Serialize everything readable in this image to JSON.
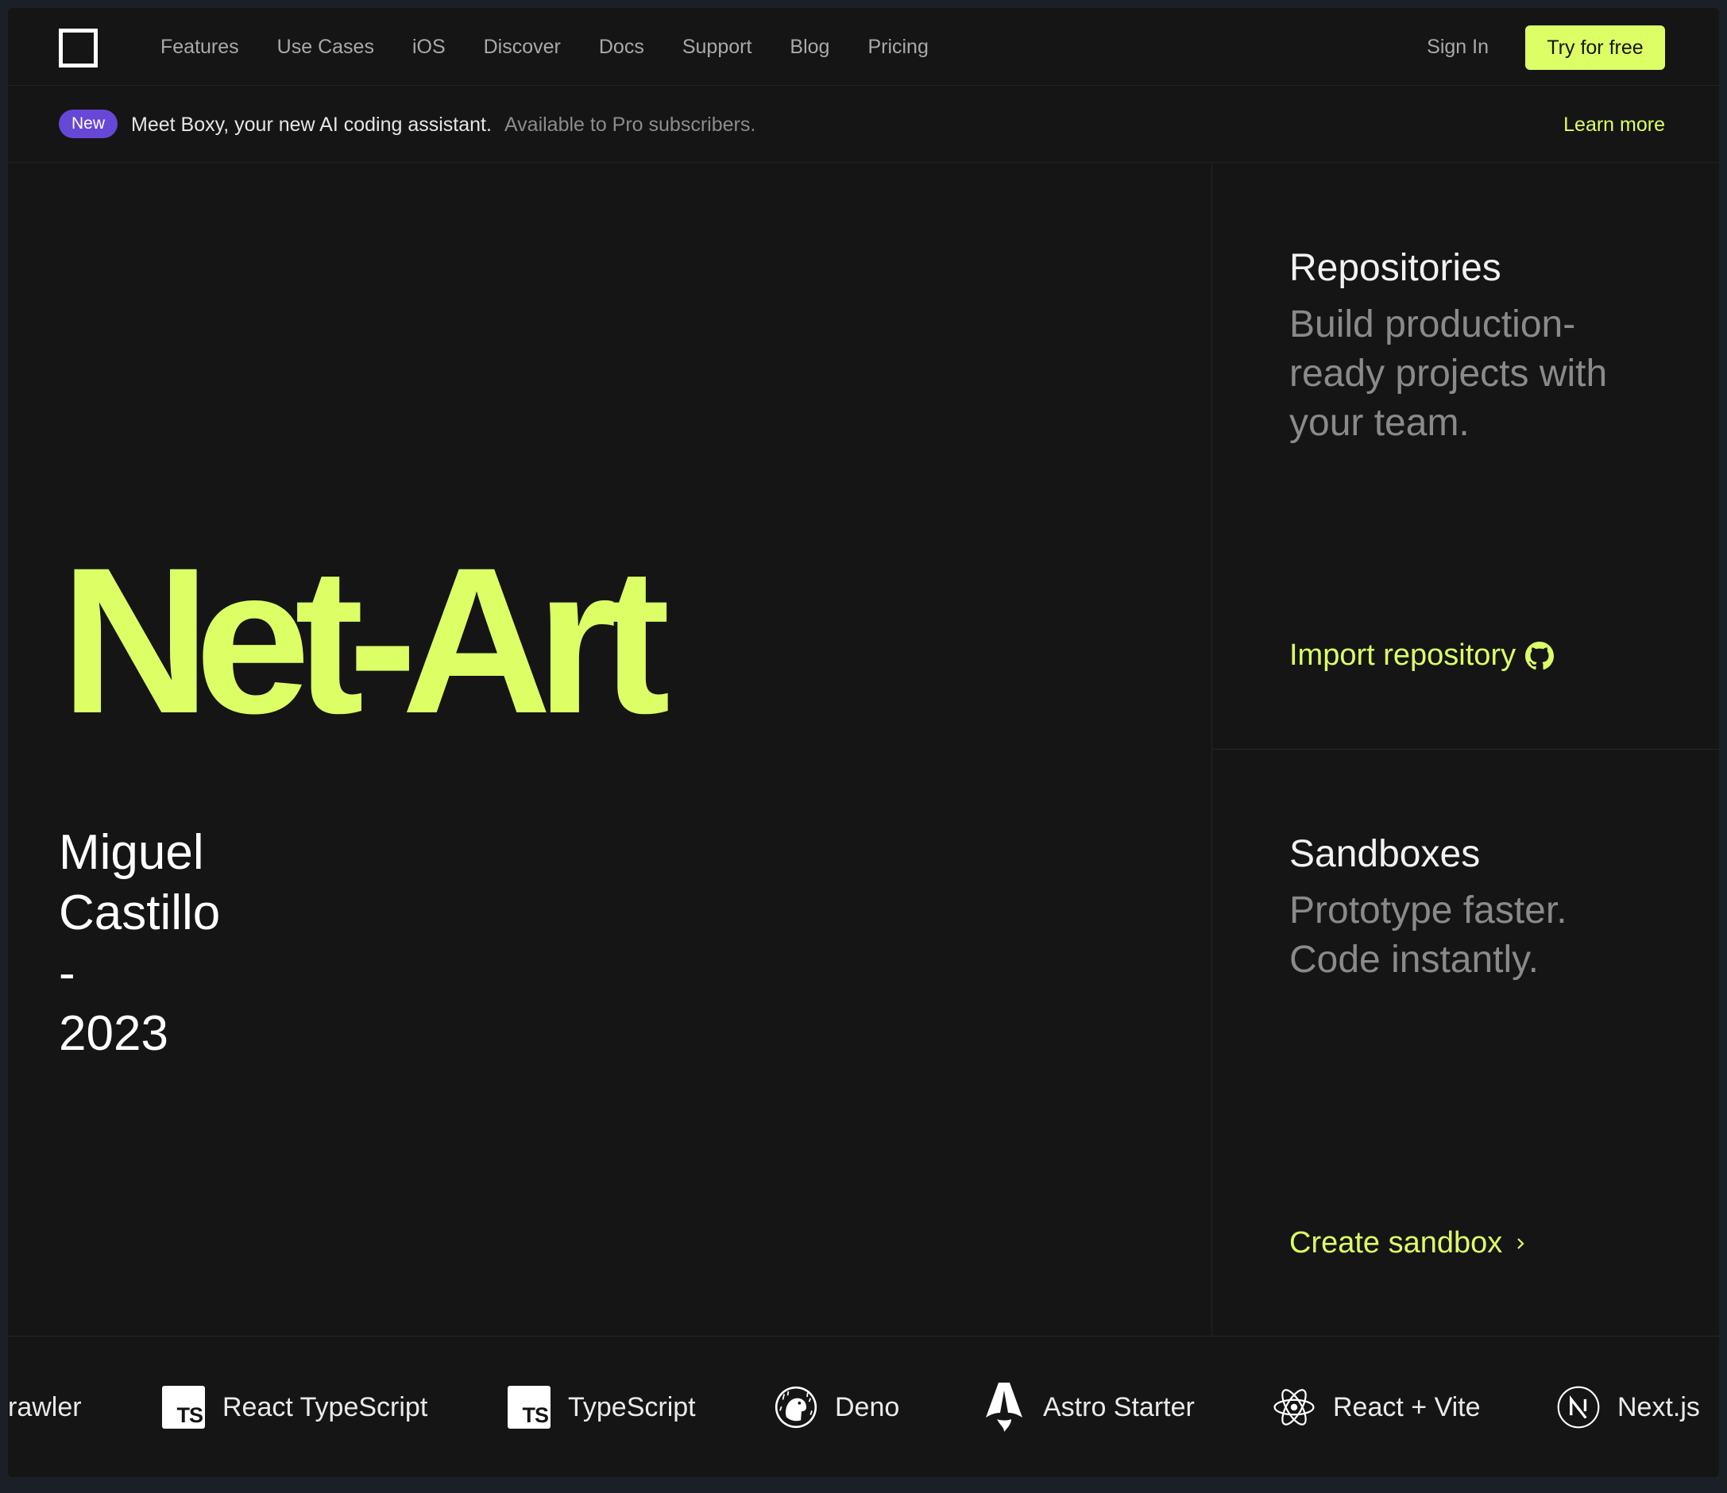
{
  "nav": {
    "links": [
      "Features",
      "Use Cases",
      "iOS",
      "Discover",
      "Docs",
      "Support",
      "Blog",
      "Pricing"
    ],
    "sign_in": "Sign In",
    "cta": "Try for free"
  },
  "announcement": {
    "badge": "New",
    "message": "Meet Boxy, your new AI coding assistant.",
    "sub": "Available to Pro subscribers.",
    "link": "Learn more"
  },
  "hero": {
    "title": "Net-Art",
    "byline": [
      "Miguel",
      "Castillo",
      "-",
      "2023"
    ]
  },
  "panels": {
    "repositories": {
      "title": "Repositories",
      "description": "Build production-ready projects with your team.",
      "link": "Import repository",
      "link_icon": "github-icon"
    },
    "sandboxes": {
      "title": "Sandboxes",
      "description": "Prototype faster. Code instantly.",
      "link": "Create sandbox",
      "link_icon": "chevron-right-icon"
    }
  },
  "templates": [
    {
      "label": "rawler",
      "icon": ""
    },
    {
      "label": "React TypeScript",
      "icon": "typescript-icon"
    },
    {
      "label": "TypeScript",
      "icon": "typescript-icon"
    },
    {
      "label": "Deno",
      "icon": "deno-icon"
    },
    {
      "label": "Astro Starter",
      "icon": "astro-icon"
    },
    {
      "label": "React + Vite",
      "icon": "react-icon"
    },
    {
      "label": "Next.js",
      "icon": "nextjs-icon"
    }
  ],
  "colors": {
    "accent": "#dcff66",
    "background": "#151515",
    "badge": "#6647d6",
    "muted_text": "#8a8a8a"
  }
}
